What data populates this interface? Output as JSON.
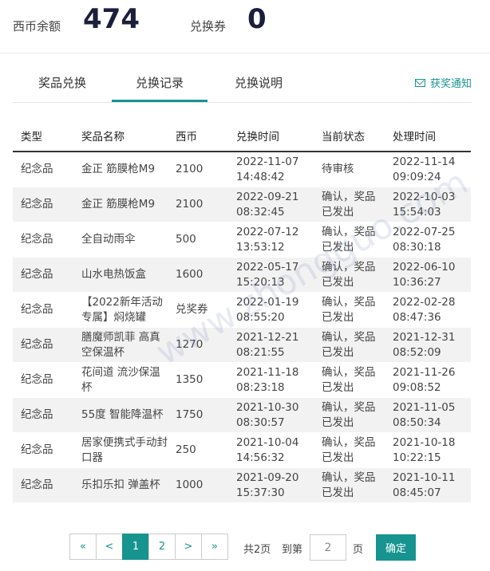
{
  "header": {
    "balance_label": "西币余额",
    "balance_value": "474",
    "voucher_label": "兑换券",
    "voucher_value": "0"
  },
  "tabs": [
    {
      "label": "奖品兑换"
    },
    {
      "label": "兑换记录"
    },
    {
      "label": "兑换说明"
    }
  ],
  "active_tab": "兑换记录",
  "notify_label": "获奖通知",
  "table": {
    "headers": [
      "类型",
      "奖品名称",
      "西币",
      "兑换时间",
      "当前状态",
      "处理时间"
    ],
    "rows": [
      {
        "type": "纪念品",
        "name": "金正 筋膜枪M9",
        "coin": "2100",
        "time": "2022-11-07 14:48:42",
        "status": "待审核",
        "handled": "2022-11-14 09:09:24"
      },
      {
        "type": "纪念品",
        "name": "金正 筋膜枪M9",
        "coin": "2100",
        "time": "2022-09-21 08:32:45",
        "status": "确认，奖品已发出",
        "handled": "2022-10-03 15:54:03"
      },
      {
        "type": "纪念品",
        "name": "全自动雨伞",
        "coin": "500",
        "time": "2022-07-12 13:53:12",
        "status": "确认，奖品已发出",
        "handled": "2022-07-25 08:30:18"
      },
      {
        "type": "纪念品",
        "name": "山水电热饭盒",
        "coin": "1600",
        "time": "2022-05-17 15:20:13",
        "status": "确认，奖品已发出",
        "handled": "2022-06-10 10:36:27"
      },
      {
        "type": "纪念品",
        "name": "【2022新年活动专属】焖烧罐",
        "coin": "兑奖券",
        "time": "2022-01-19 08:55:20",
        "status": "确认，奖品已发出",
        "handled": "2022-02-28 08:47:36"
      },
      {
        "type": "纪念品",
        "name": "膳魔师凯菲 高真空保温杯",
        "coin": "1270",
        "time": "2021-12-21 08:21:55",
        "status": "确认，奖品已发出",
        "handled": "2021-12-31 08:52:09"
      },
      {
        "type": "纪念品",
        "name": "花间道 流沙保温杯",
        "coin": "1350",
        "time": "2021-11-18 08:23:18",
        "status": "确认，奖品已发出",
        "handled": "2021-11-26 09:08:52"
      },
      {
        "type": "纪念品",
        "name": "55度 智能降温杯",
        "coin": "1750",
        "time": "2021-10-30 08:30:57",
        "status": "确认，奖品已发出",
        "handled": "2021-11-05 08:50:34"
      },
      {
        "type": "纪念品",
        "name": "居家便携式手动封口器",
        "coin": "250",
        "time": "2021-10-04 14:56:32",
        "status": "确认，奖品已发出",
        "handled": "2021-10-18 10:22:15"
      },
      {
        "type": "纪念品",
        "name": "乐扣乐扣 弹盖杯",
        "coin": "1000",
        "time": "2021-09-20 15:37:30",
        "status": "确认，奖品已发出",
        "handled": "2021-10-11 08:45:07"
      }
    ]
  },
  "pagination": {
    "first": "«",
    "prev": "<",
    "pages": [
      "1",
      "2"
    ],
    "current": "1",
    "next": ">",
    "last": "»",
    "total_text": "共2页",
    "goto_label": "到第",
    "goto_value": "2",
    "page_unit": "页",
    "confirm_label": "确定"
  },
  "colors": {
    "accent": "#17948f",
    "stripe": "#f2f2f2"
  }
}
